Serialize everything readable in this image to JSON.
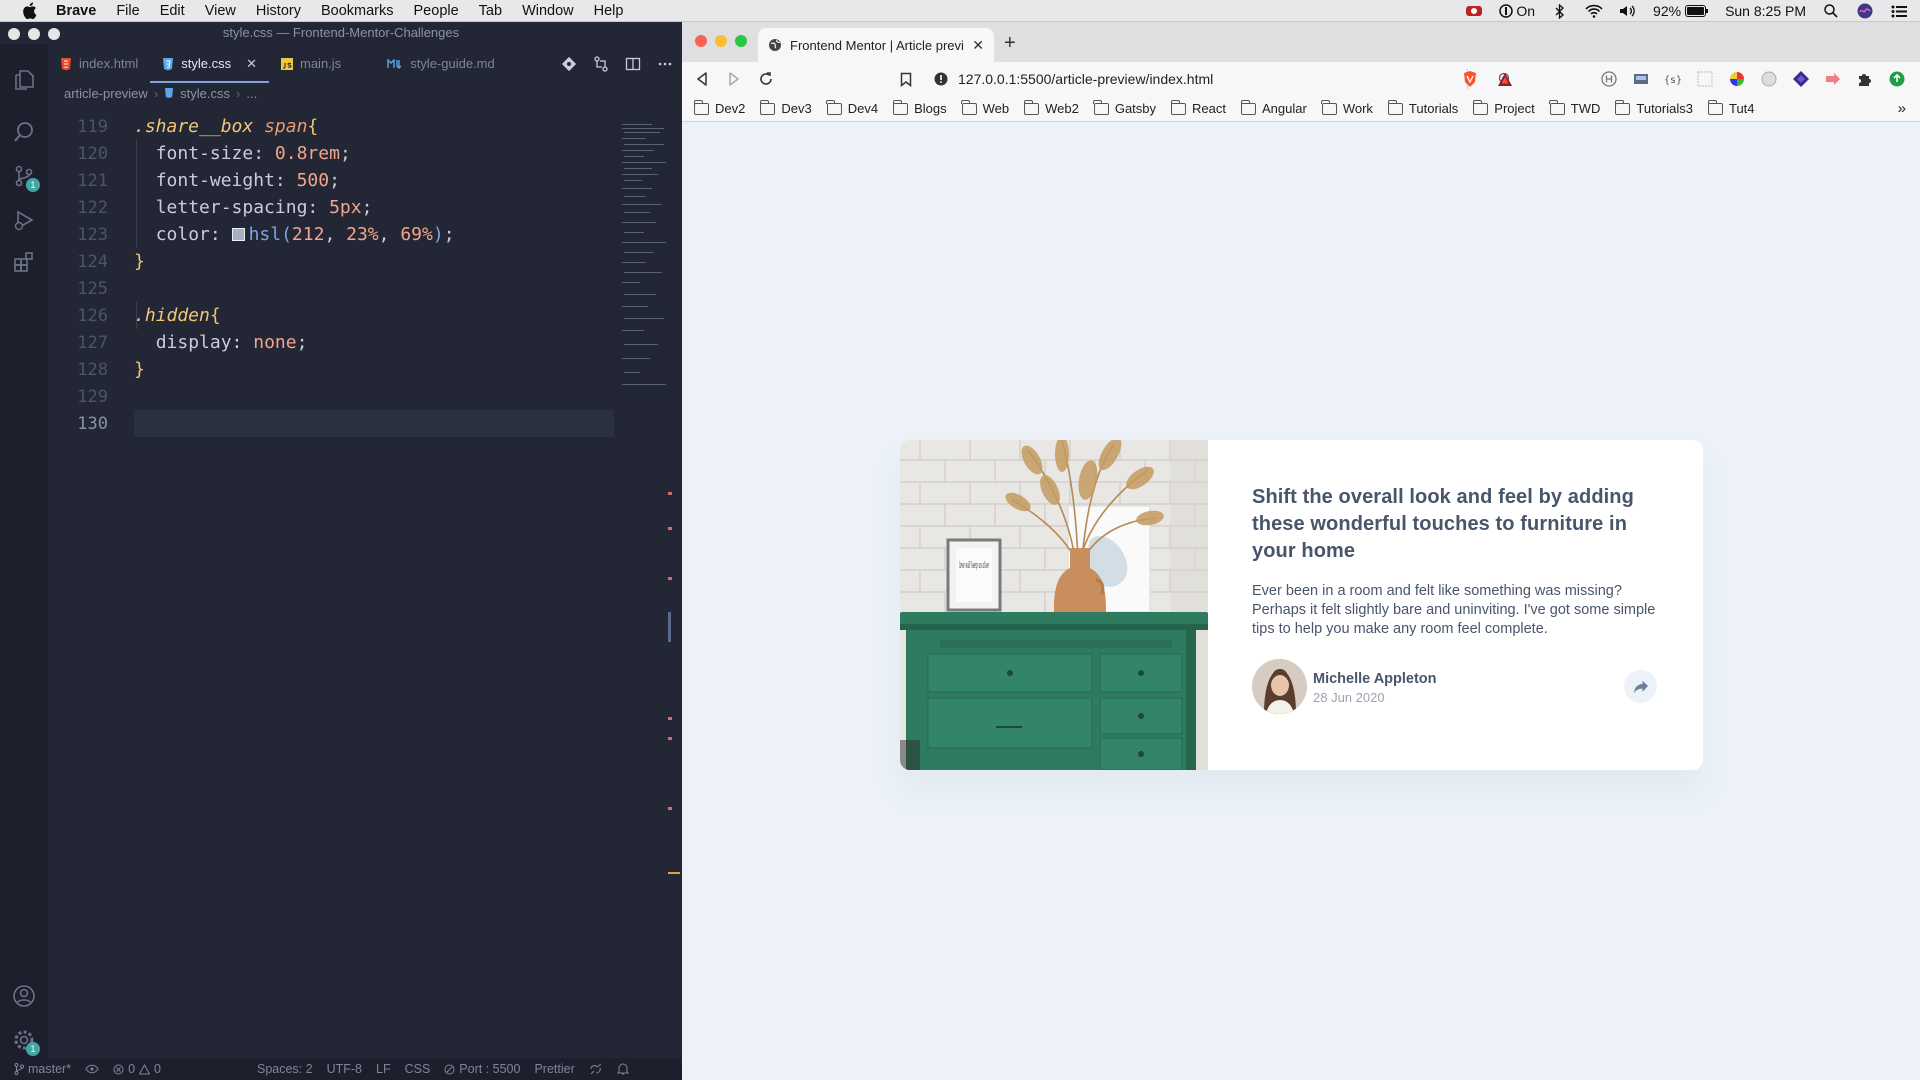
{
  "menubar": {
    "app_name": "Brave",
    "items": [
      "File",
      "Edit",
      "View",
      "History",
      "Bookmarks",
      "People",
      "Tab",
      "Window",
      "Help"
    ],
    "status": {
      "vpn": "On",
      "battery": "92%",
      "clock": "Sun 8:25 PM"
    }
  },
  "vscode": {
    "window_title": "style.css — Frontend-Mentor-Challenges",
    "tabs": [
      {
        "label": "index.html",
        "icon": "html5-icon",
        "icon_color": "#e44d26"
      },
      {
        "label": "style.css",
        "icon": "css3-icon",
        "icon_color": "#5aa7e8",
        "active": true
      },
      {
        "label": "main.js",
        "icon": "javascript-icon",
        "icon_color": "#f0c742"
      },
      {
        "label": "style-guide.md",
        "icon": "markdown-icon",
        "icon_color": "#5aa7e8"
      }
    ],
    "breadcrumb": {
      "folder": "article-preview",
      "file": "style.css",
      "more": "..."
    },
    "source_control_badge": "1",
    "settings_badge": "1",
    "code": {
      "l119": {
        "ln": "119",
        "sel": ".share__box",
        "tag": "span",
        "brace": "{"
      },
      "l120": {
        "ln": "120",
        "prop": "font-size",
        "val": "0.8rem"
      },
      "l121": {
        "ln": "121",
        "prop": "font-weight",
        "val": "500"
      },
      "l122": {
        "ln": "122",
        "prop": "letter-spacing",
        "val": "5px"
      },
      "l123": {
        "ln": "123",
        "prop": "color",
        "fn": "hsl",
        "a": "212",
        "b": "23%",
        "c": "69%"
      },
      "l124": {
        "ln": "124",
        "brace": "}"
      },
      "l125": {
        "ln": "125"
      },
      "l126": {
        "ln": "126",
        "sel": ".hidden",
        "brace": "{"
      },
      "l127": {
        "ln": "127",
        "prop": "display",
        "val": "none"
      },
      "l128": {
        "ln": "128",
        "brace": "}"
      },
      "l129": {
        "ln": "129"
      },
      "l130": {
        "ln": "130"
      }
    },
    "statusbar": {
      "branch": "master*",
      "problems": "0",
      "warnings": "0",
      "spaces": "Spaces: 2",
      "encoding": "UTF-8",
      "eol": "LF",
      "language": "CSS",
      "port": "Port : 5500",
      "formatter": "Prettier"
    }
  },
  "browser": {
    "tab_title": "Frontend Mentor | Article preview",
    "url": "127.0.0.1:5500/article-preview/index.html",
    "bookmarks": [
      "Dev2",
      "Dev3",
      "Dev4",
      "Blogs",
      "Web",
      "Web2",
      "Gatsby",
      "React",
      "Angular",
      "Work",
      "Tutorials",
      "Project",
      "TWD",
      "Tutorials3",
      "Tut4"
    ],
    "bookmarks_more": "»"
  },
  "article": {
    "title": "Shift the overall look and feel by adding these wonderful touches to furniture in your home",
    "description": "Ever been in a room and felt like something was missing? Perhaps it felt slightly bare and uninviting. I've got some simple tips to help you make any room feel complete.",
    "author_name": "Michelle Appleton",
    "date": "28 Jun 2020",
    "frame_text": "love will keep us alive"
  },
  "colors": {
    "page_bg": "#ecf2f8",
    "text": "#48556a",
    "muted": "#9aa3b4",
    "dresser": "#2e7b5f"
  }
}
